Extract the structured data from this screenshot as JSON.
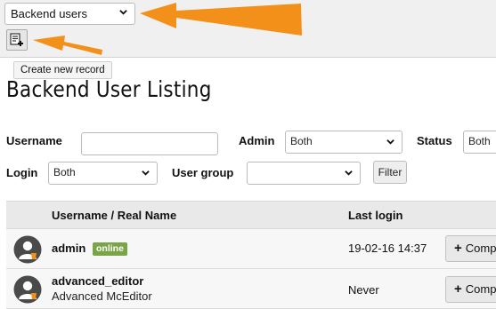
{
  "module_select": {
    "value": "Backend users"
  },
  "toolbar": {
    "new_record_tooltip": "Create new record"
  },
  "page": {
    "title": "Backend User Listing"
  },
  "filters": {
    "username_label": "Username",
    "username_value": "",
    "admin_label": "Admin",
    "admin_value": "Both",
    "status_label": "Status",
    "status_value": "Both",
    "login_label": "Login",
    "login_value": "Both",
    "usergroup_label": "User group",
    "usergroup_value": "",
    "filter_button": "Filter"
  },
  "table": {
    "columns": [
      "Username / Real Name",
      "Last login"
    ],
    "rows": [
      {
        "username": "admin",
        "real_name": "",
        "badge": "online",
        "last_login": "19-02-16 14:37",
        "action": "Comp"
      },
      {
        "username": "advanced_editor",
        "real_name": "Advanced McEditor",
        "badge": "",
        "last_login": "Never",
        "action": "Comp"
      }
    ]
  },
  "colors": {
    "arrow": "#f39019",
    "online_badge": "#79a548"
  }
}
